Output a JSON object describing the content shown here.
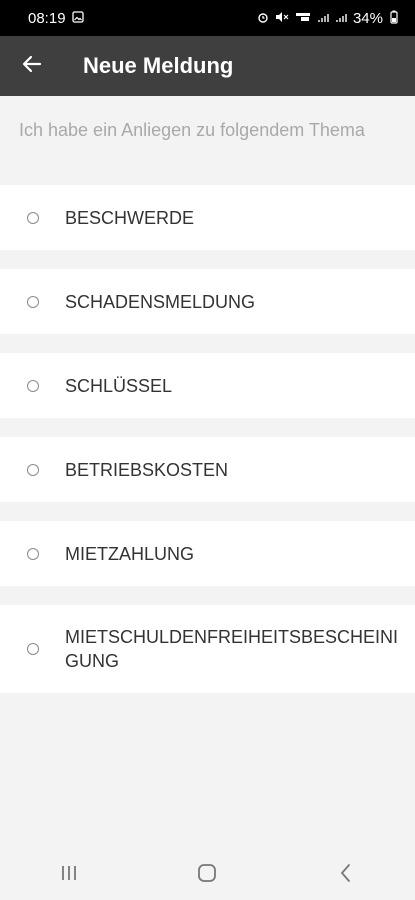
{
  "status_bar": {
    "time": "08:19",
    "battery": "34%",
    "icons": [
      "image-icon",
      "alarm-icon",
      "mute-icon",
      "volte-icon",
      "signal-icon",
      "signal-icon",
      "battery-icon"
    ]
  },
  "app_bar": {
    "title": "Neue Meldung",
    "back_icon": "arrow-left-icon"
  },
  "intro": "Ich habe ein Anliegen zu folgendem Thema",
  "options": [
    {
      "label": "BESCHWERDE"
    },
    {
      "label": "SCHADENSMELDUNG"
    },
    {
      "label": "SCHLÜSSEL"
    },
    {
      "label": "BETRIEBSKOSTEN"
    },
    {
      "label": "MIETZAHLUNG"
    },
    {
      "label": "MIETSCHULDENFREIHEITSBESCHEINIGUNG"
    }
  ],
  "colors": {
    "app_bar": "#3f3f3f",
    "background": "#f3f3f3",
    "option_background": "#ffffff",
    "text": "#333333",
    "muted_text": "#a9a9a9"
  }
}
